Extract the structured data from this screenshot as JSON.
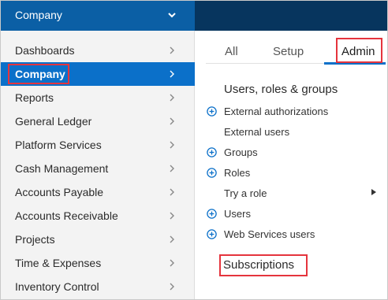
{
  "header": {
    "title": "Company",
    "icon": "chevron-down-icon"
  },
  "colors": {
    "header_blue": "#0b5fa5",
    "header_dark": "#07355e",
    "active_blue": "#0b70c9",
    "highlight_red": "#e5343d"
  },
  "sidebar": {
    "items": [
      {
        "label": "Dashboards"
      },
      {
        "label": "Company"
      },
      {
        "label": "Reports"
      },
      {
        "label": "General Ledger"
      },
      {
        "label": "Platform Services"
      },
      {
        "label": "Cash Management"
      },
      {
        "label": "Accounts Payable"
      },
      {
        "label": "Accounts Receivable"
      },
      {
        "label": "Projects"
      },
      {
        "label": "Time & Expenses"
      },
      {
        "label": "Inventory Control"
      }
    ],
    "active": "Company"
  },
  "tabs": [
    {
      "label": "All"
    },
    {
      "label": "Setup"
    },
    {
      "label": "Admin"
    }
  ],
  "active_tab": "Admin",
  "section": {
    "title": "Users, roles & groups",
    "items": [
      {
        "label": "External authorizations",
        "icon": "plus-circle-icon"
      },
      {
        "label": "External users"
      },
      {
        "label": "Groups",
        "icon": "plus-circle-icon"
      },
      {
        "label": "Roles",
        "icon": "plus-circle-icon"
      },
      {
        "label": "Try a role",
        "icon": "caret-right-icon"
      },
      {
        "label": "Users",
        "icon": "plus-circle-icon"
      },
      {
        "label": "Web Services users",
        "icon": "plus-circle-icon"
      }
    ]
  },
  "subscriptions": {
    "label": "Subscriptions"
  }
}
